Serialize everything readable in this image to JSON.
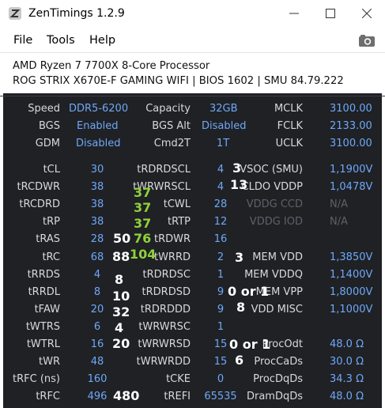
{
  "window": {
    "title": "ZenTimings 1.2.9"
  },
  "menu": {
    "file": "File",
    "tools": "Tools",
    "help": "Help"
  },
  "system": {
    "cpu": "AMD Ryzen 7 7700X 8-Core Processor",
    "board": "ROG STRIX X670E-F GAMING WIFI | BIOS 1602 | SMU 84.79.222"
  },
  "top": {
    "speed_label": "Speed",
    "speed": "DDR5-6200",
    "capacity_label": "Capacity",
    "capacity": "32GB",
    "mclk_label": "MCLK",
    "mclk": "3100.00",
    "bgs_label": "BGS",
    "bgs": "Enabled",
    "bgsalt_label": "BGS Alt",
    "bgsalt": "Disabled",
    "fclk_label": "FCLK",
    "fclk": "2133.00",
    "gdm_label": "GDM",
    "gdm": "Disabled",
    "cmd2t_label": "Cmd2T",
    "cmd2t": "1T",
    "uclk_label": "UCLK",
    "uclk": "3100.00"
  },
  "col1": [
    {
      "label": "tCL",
      "value": "30"
    },
    {
      "label": "tRCDWR",
      "value": "38"
    },
    {
      "label": "tRCDRD",
      "value": "38"
    },
    {
      "label": "tRP",
      "value": "38"
    },
    {
      "label": "tRAS",
      "value": "28"
    },
    {
      "label": "tRC",
      "value": "68"
    },
    {
      "label": "tRRDS",
      "value": "4"
    },
    {
      "label": "tRRDL",
      "value": "8"
    },
    {
      "label": "tFAW",
      "value": "20"
    },
    {
      "label": "tWTRS",
      "value": "6"
    },
    {
      "label": "tWTRL",
      "value": "16"
    },
    {
      "label": "tWR",
      "value": "48"
    },
    {
      "label": "tRFC (ns)",
      "value": "160"
    },
    {
      "label": "tRFC",
      "value": "496"
    }
  ],
  "col2": [
    {
      "label": "tRDRDSCL",
      "value": "4"
    },
    {
      "label": "tWRWRSCL",
      "value": "4"
    },
    {
      "label": "tCWL",
      "value": "28"
    },
    {
      "label": "tRTP",
      "value": "12"
    },
    {
      "label": "tRDWR",
      "value": "16"
    },
    {
      "label": "tWRRD",
      "value": "2"
    },
    {
      "label": "tRDRDSC",
      "value": "1"
    },
    {
      "label": "tRDRDSD",
      "value": "9"
    },
    {
      "label": "tRDRDDD",
      "value": "9"
    },
    {
      "label": "tWRWRSC",
      "value": "1"
    },
    {
      "label": "tWRWRSD",
      "value": "15"
    },
    {
      "label": "tWRWRDD",
      "value": "15"
    },
    {
      "label": "tCKE",
      "value": "0"
    },
    {
      "label": "tREFI",
      "value": "65535"
    }
  ],
  "col3": [
    {
      "label": "VSOC (SMU)",
      "value": "1,1900V",
      "disabled": false
    },
    {
      "label": "CLDO VDDP",
      "value": "1,0478V",
      "disabled": false
    },
    {
      "label": "VDDG CCD",
      "value": "N/A",
      "disabled": true
    },
    {
      "label": "VDDG IOD",
      "value": "N/A",
      "disabled": true
    },
    {
      "label": "",
      "value": "",
      "disabled": false
    },
    {
      "label": "MEM VDD",
      "value": "1,3850V",
      "disabled": false
    },
    {
      "label": "MEM VDDQ",
      "value": "1,1400V",
      "disabled": false
    },
    {
      "label": "MEM VPP",
      "value": "1,8000V",
      "disabled": false
    },
    {
      "label": "VDD MISC",
      "value": "1,1000V",
      "disabled": false
    },
    {
      "label": "",
      "value": "",
      "disabled": false
    },
    {
      "label": "ProcOdt",
      "value": "48.0 Ω",
      "disabled": false
    },
    {
      "label": "ProcCaDs",
      "value": "30.0 Ω",
      "disabled": false
    },
    {
      "label": "ProcDqDs",
      "value": "34.3 Ω",
      "disabled": false
    },
    {
      "label": "DramDqDs",
      "value": "48.0 Ω",
      "disabled": false
    }
  ],
  "annotations": {
    "rdrdscl": "3",
    "wrwrscl": "13",
    "rcdwr": "37",
    "rcdrd": "37",
    "rp": "37",
    "ras_w": "50",
    "ras_g": "76",
    "rc_w": "88",
    "rc_g": "104",
    "wrrd": "3",
    "rrds": "8",
    "rrdl": "10",
    "faw": "32",
    "wtrs": "4",
    "wtrl": "20",
    "rdrdsd": "0 or 1",
    "rdrddd": "8",
    "wrwrsd": "0 or 1",
    "wrwrdd": "6",
    "rfc": "480"
  }
}
